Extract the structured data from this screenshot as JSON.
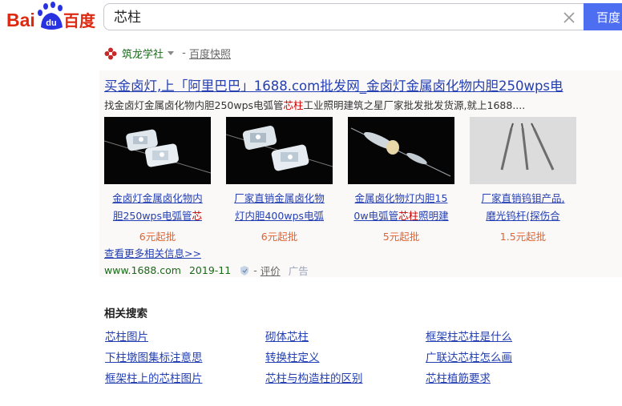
{
  "header": {
    "logo_text_left": "Bai",
    "logo_badge": "du",
    "logo_text_right": "百度",
    "query": "芯柱",
    "search_button": "百度"
  },
  "source": {
    "name": "筑龙学社",
    "separator": " - ",
    "snapshot": "百度快照"
  },
  "ad": {
    "title": "买金卤灯,上「阿里巴巴」1688.com批发网_金卤灯金属卤化物内胆250wps电",
    "desc_pre": "找金卤灯金属卤化物内胆250wps电弧管",
    "desc_highlight": "芯柱",
    "desc_post": "工业照明建筑之星厂家批发批发货源,就上1688....",
    "products": [
      {
        "line1": "金卤灯金属卤化物内",
        "line2_pre": "胆250wps电弧管",
        "line2_hl": "芯",
        "line2_post": "",
        "price": "6元起批"
      },
      {
        "line1": "厂家直销金属卤化物",
        "line2_pre": "灯内胆400wps电弧",
        "line2_hl": "",
        "line2_post": "",
        "price": "6元起批"
      },
      {
        "line1": "金属卤化物灯内胆15",
        "line2_pre": "0w电弧管",
        "line2_hl": "芯柱",
        "line2_post": "照明建",
        "price": "5元起批"
      },
      {
        "line1": "厂家直销钨钼产品,",
        "line2_pre": "磨光钨杆(探伤合",
        "line2_hl": "",
        "line2_post": "",
        "price": "1.5元起批"
      }
    ],
    "more": "查看更多相关信息>>",
    "site": "www.1688.com",
    "date": "2019-11",
    "eval_sep": "-",
    "eval": "评价",
    "tag": "广告"
  },
  "related": {
    "title": "相关搜索",
    "items": [
      [
        "芯柱图片",
        "砌体芯柱",
        "框架柱芯柱是什么"
      ],
      [
        "下柱墩图集标注意思",
        "转换柱定义",
        "广联达芯柱怎么画"
      ],
      [
        "框架柱上的芯柱图片",
        "芯柱与构造柱的区别",
        "芯柱植筋要求"
      ]
    ]
  },
  "colors": {
    "link": "#2440b3",
    "price": "#e4622e",
    "green": "#1a6a1a",
    "button": "#4e6ef2",
    "logo_red": "#de2910",
    "logo_blue": "#2932e1"
  }
}
